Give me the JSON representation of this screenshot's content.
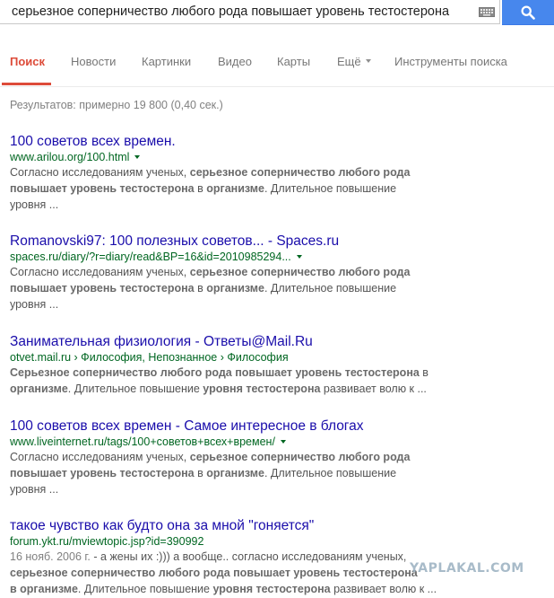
{
  "search": {
    "query": "серьезное соперничество любого рода повышает уровень тестостерона",
    "keyboard_icon": "keyboard-icon",
    "search_icon": "magnifier-icon",
    "accent_color": "#4787ed"
  },
  "tabs": {
    "items": [
      {
        "label": "Поиск",
        "active": true
      },
      {
        "label": "Новости"
      },
      {
        "label": "Картинки"
      },
      {
        "label": "Видео"
      },
      {
        "label": "Карты"
      },
      {
        "label": "Ещё"
      },
      {
        "label": "Инструменты поиска"
      }
    ],
    "active_color": "#dd4b39"
  },
  "stats": "Результатов: примерно 19 800 (0,40 сек.)",
  "results": [
    {
      "title": "100 советов всех времен.",
      "url": "www.arilou.org/100.html",
      "snippet": {
        "l1_a": "Согласно исследованиям ученых, ",
        "l1_b": "серьезное соперничество любого рода",
        "l2_a": "повышает уровень тестостерона",
        "l2_b": " в ",
        "l2_c": "организме",
        "l2_d": ". Длительное повышение",
        "l3": "уровня ..."
      }
    },
    {
      "title": "Romanovski97: 100 полезных советов... - Spaces.ru",
      "url": "spaces.ru/diary/?r=diary/read&BP=16&id=2010985294...",
      "snippet": {
        "l1_a": "Согласно исследованиям ученых, ",
        "l1_b": "серьезное соперничество любого рода",
        "l2_a": "повышает уровень тестостерона",
        "l2_b": " в ",
        "l2_c": "организме",
        "l2_d": ". Длительное повышение",
        "l3": "уровня ..."
      }
    },
    {
      "title": "Занимательная физиология - Ответы@Mail.Ru",
      "url": "otvet.mail.ru › Философия, Непознанное › Философия",
      "snippet": {
        "l1_a": "Серьезное соперничество любого рода повышает уровень тестостерона",
        "l1_b": " в",
        "l2_a": "организме",
        "l2_b": ". Длительное повышение ",
        "l2_c": "уровня тестостерона",
        "l2_d": " развивает волю к ..."
      }
    },
    {
      "title": "100 советов всех времен - Самое интересное в блогах",
      "url": "www.liveinternet.ru/tags/100+советов+всех+времен/",
      "snippet": {
        "l1_a": "Согласно исследованиям ученых, ",
        "l1_b": "серьезное соперничество любого рода",
        "l2_a": "повышает уровень тестостерона",
        "l2_b": " в ",
        "l2_c": "организме",
        "l2_d": ". Длительное повышение",
        "l3": "уровня ..."
      }
    },
    {
      "title": "такое чувство как будто она за мной \"гоняется\"",
      "url": "forum.ykt.ru/mviewtopic.jsp?id=390992",
      "snippet": {
        "date": "16 нояб. 2006 г.",
        "l1_rest": " - а жены их :))) а вообще.. согласно исследованиям ученых,",
        "l2_a": "серьезное соперничество любого рода повышает уровень тестостерона",
        "l3_a": "в организме",
        "l3_b": ". Длительное повышение ",
        "l3_c": "уровня тестостерона",
        "l3_d": " развивает волю к ..."
      }
    }
  ],
  "watermark": "YAPLAKAL.COM"
}
